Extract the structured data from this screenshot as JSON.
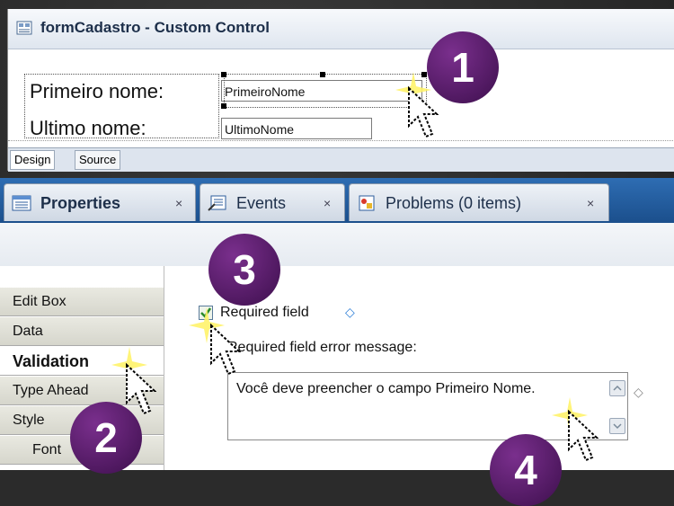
{
  "editor": {
    "title": "formCadastro - Custom Control",
    "label_first": "Primeiro nome:",
    "label_last": "Ultimo nome:",
    "field_first": "PrimeiroNome",
    "field_last": "UltimoNome",
    "mode_tabs": [
      "Design",
      "Source"
    ]
  },
  "views": {
    "properties": "Properties",
    "events": "Events",
    "problems": "Problems (0 items)",
    "close": "×"
  },
  "sidebar": {
    "items": [
      "Edit Box",
      "Data",
      "Validation",
      "Type Ahead",
      "Style",
      "Font"
    ],
    "active": "Validation"
  },
  "validation": {
    "required_label": "Required field",
    "error_label": "Required field error message:",
    "error_value": "Você deve preencher o campo Primeiro Nome."
  },
  "callouts": [
    "1",
    "2",
    "3",
    "4"
  ],
  "colors": {
    "badge": "#5a1f6e",
    "tab_band": "#2e6db3",
    "diamond": "#2a7dd6"
  }
}
